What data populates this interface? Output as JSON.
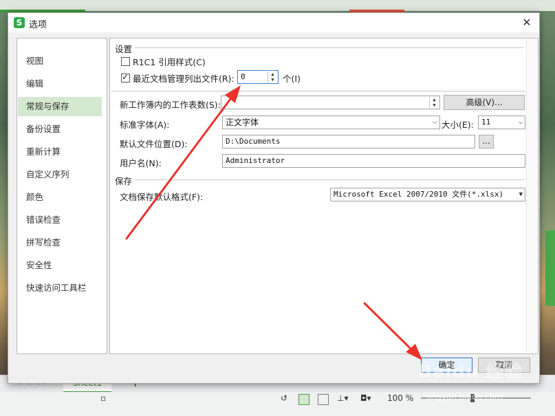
{
  "window": {
    "title": "选项",
    "app_icon": "S"
  },
  "nav": {
    "items": [
      {
        "label": "视图"
      },
      {
        "label": "编辑"
      },
      {
        "label": "常规与保存"
      },
      {
        "label": "备份设置"
      },
      {
        "label": "重新计算"
      },
      {
        "label": "自定义序列"
      },
      {
        "label": "颜色"
      },
      {
        "label": "错误检查"
      },
      {
        "label": "拼写检查"
      },
      {
        "label": "安全性"
      },
      {
        "label": "快速访问工具栏"
      }
    ],
    "active_index": 2
  },
  "settings": {
    "section_label": "设置",
    "r1c1_label": "R1C1 引用样式(C)",
    "r1c1_checked": false,
    "recent_label": "最近文档管理列出文件(R):",
    "recent_checked": true,
    "recent_value": "0",
    "recent_unit": "个(I)",
    "sheets_label": "新工作簿内的工作表数(S):",
    "sheets_value": "",
    "advanced_button": "高级(V)...",
    "font_label": "标准字体(A):",
    "font_value": "正文字体",
    "size_label": "大小(E):",
    "size_value": "11",
    "location_label": "默认文件位置(D):",
    "location_value": "D:\\Documents",
    "browse_button": "...",
    "username_label": "用户名(N):",
    "username_value": "Administrator"
  },
  "save": {
    "section_label": "保存",
    "format_label": "文档保存默认格式(F):",
    "format_value": "Microsoft Excel 2007/2010 文件(*.xlsx)"
  },
  "footer": {
    "ok": "确定",
    "cancel": "取消"
  },
  "sheet_bar": {
    "tab": "Sheet1"
  },
  "status": {
    "zoom": "100 %"
  },
  "watermark": {
    "brand": "Baidu 经验",
    "sub": "jingyan.baidu.com"
  },
  "colors": {
    "accent_green": "#3f9a3a",
    "nav_active": "#d5e8d0",
    "annotation_arrow": "#e8342b",
    "focus_blue": "#3b7bd6"
  }
}
